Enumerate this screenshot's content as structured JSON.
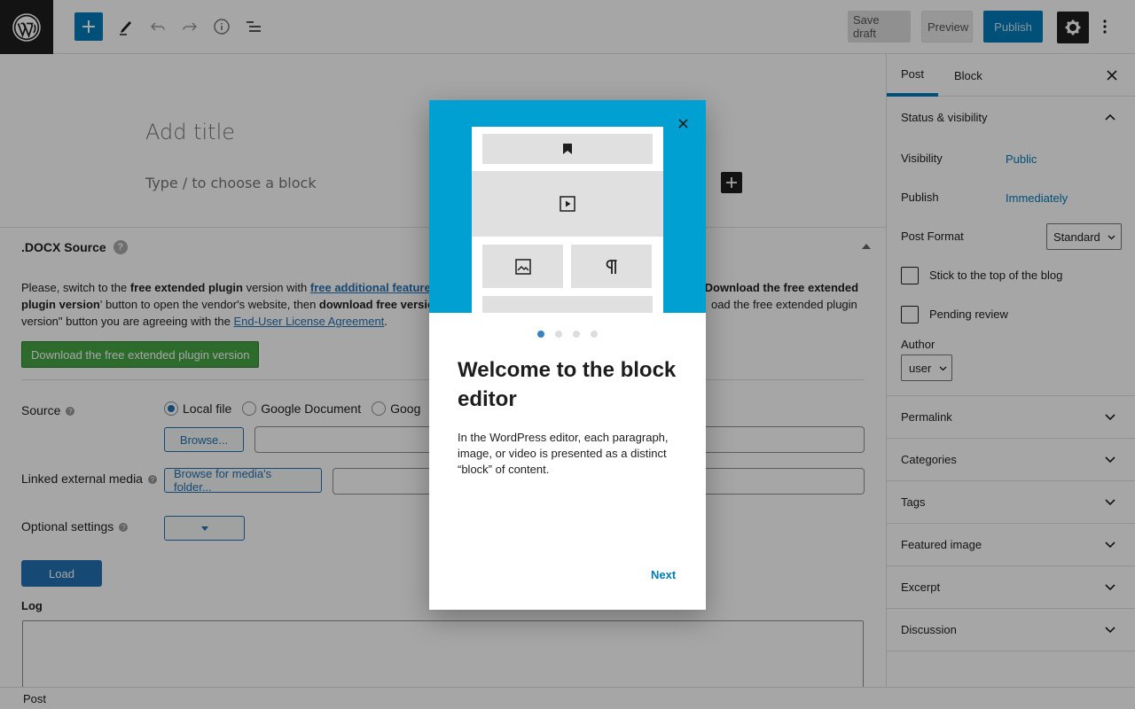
{
  "topbar": {
    "save_draft": "Save draft",
    "preview": "Preview",
    "publish": "Publish"
  },
  "editor": {
    "title_placeholder": "Add title",
    "block_placeholder": "Type / to choose a block"
  },
  "metabox": {
    "title": ".DOCX Source",
    "help": "?",
    "text_1": "Please, switch to the ",
    "text_bold_1": "free extended plugin",
    "text_2": " version with ",
    "link_1": "free additional feature",
    "text_3": "Download the free extended",
    "text_bold_2": "plugin version",
    "text_4": "' button to open the vendor's website, then ",
    "text_bold_3": "download free versio",
    "text_5": "oad the free extended plugin",
    "text_6": "version\" button you are agreeing with the ",
    "link_2": "End-User License Agreement",
    "text_7": ".",
    "download_button": "Download the free extended plugin version",
    "source_label": "Source",
    "source_options": [
      "Local file",
      "Google Document",
      "Goog"
    ],
    "browse_button": "Browse...",
    "linked_media_label": "Linked external media",
    "browse_media_button": "Browse for media's folder...",
    "optional_settings_label": "Optional settings",
    "load_button": "Load",
    "log_label": "Log"
  },
  "sidebar": {
    "tabs": [
      "Post",
      "Block"
    ],
    "status_title": "Status & visibility",
    "visibility_label": "Visibility",
    "visibility_value": "Public",
    "publish_label": "Publish",
    "publish_value": "Immediately",
    "post_format_label": "Post Format",
    "post_format_value": "Standard",
    "stick_label": "Stick to the top of the blog",
    "pending_label": "Pending review",
    "author_label": "Author",
    "author_value": "user",
    "panels": [
      "Permalink",
      "Categories",
      "Tags",
      "Featured image",
      "Excerpt",
      "Discussion"
    ]
  },
  "statusbar": {
    "label": "Post"
  },
  "modal": {
    "title": "Welcome to the block editor",
    "body": "In the WordPress editor, each paragraph, image, or video is presented as a distinct “block” of content.",
    "next": "Next",
    "page_count": 4,
    "current_page": 1
  },
  "colors": {
    "accent": "#007cba",
    "hero": "#00a0d2",
    "dark": "#1e1e1e",
    "download_green": "#46a546"
  }
}
